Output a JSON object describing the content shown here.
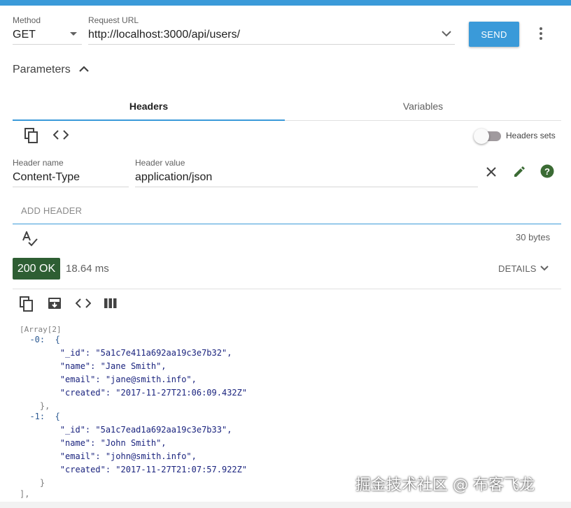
{
  "request": {
    "method_label": "Method",
    "method_value": "GET",
    "url_label": "Request URL",
    "url_value": "http://localhost:3000/api/users/",
    "send_label": "SEND"
  },
  "parameters": {
    "title": "Parameters",
    "tabs": [
      {
        "label": "Headers",
        "active": true
      },
      {
        "label": "Variables",
        "active": false
      }
    ],
    "headers_sets_label": "Headers sets",
    "header_name_label": "Header name",
    "header_name_value": "Content-Type",
    "header_value_label": "Header value",
    "header_value_value": "application/json",
    "add_header_label": "ADD HEADER",
    "size_text": "30 bytes"
  },
  "response": {
    "status": "200 OK",
    "time": "18.64 ms",
    "details_label": "DETAILS",
    "status_color": "#2e5e33"
  },
  "json_lines": [
    "[Array[2]",
    "  -0:  {",
    "        \"_id\": \"5a1c7e411a692aa19c3e7b32\",",
    "        \"name\": \"Jane Smith\",",
    "        \"email\": \"jane@smith.info\",",
    "        \"created\": \"2017-11-27T21:06:09.432Z\"",
    "    },",
    "  -1:  {",
    "        \"_id\": \"5a1c7ead1a692aa19c3e7b33\",",
    "        \"name\": \"John Smith\",",
    "        \"email\": \"john@smith.info\",",
    "        \"created\": \"2017-11-27T21:07:57.922Z\"",
    "    }",
    "],"
  ],
  "watermark": "掘金技术社区 @ 布客飞龙",
  "colors": {
    "accent": "#3a9ad9",
    "success": "#2e5e33"
  }
}
